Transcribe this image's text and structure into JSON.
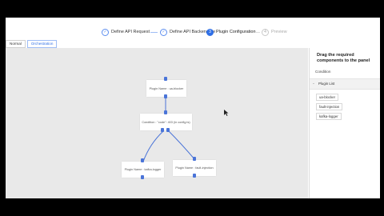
{
  "steps": [
    {
      "label": "Define API Request",
      "state": "done"
    },
    {
      "label": "Define API Backend Se",
      "state": "done"
    },
    {
      "label": "Plugin Configuration",
      "state": "active",
      "number": "3"
    },
    {
      "label": "Preview",
      "state": "pending",
      "number": "4"
    }
  ],
  "check_glyph": "✓",
  "tabs": [
    "Normal",
    "Orchestration"
  ],
  "canvas": {
    "nodes": [
      {
        "label": "Plugin Name : ua-blocker"
      },
      {
        "label": "Condition : \"code\": 403 (in config.ts)"
      },
      {
        "label": "Plugin Name : kafka-logger"
      },
      {
        "label": "Plugin Name : fault-injection"
      }
    ]
  },
  "panel": {
    "title": "Drag the required components to the panel",
    "section": "Condition",
    "group_chevron": "›",
    "group_label": "Plugin List",
    "plugins": [
      "ua-blocker",
      "fault-injection",
      "kafka-logger"
    ]
  },
  "colors": {
    "accent": "#2f6fe6",
    "link": "#4a74d8",
    "canvas": "#e9e9e9"
  }
}
